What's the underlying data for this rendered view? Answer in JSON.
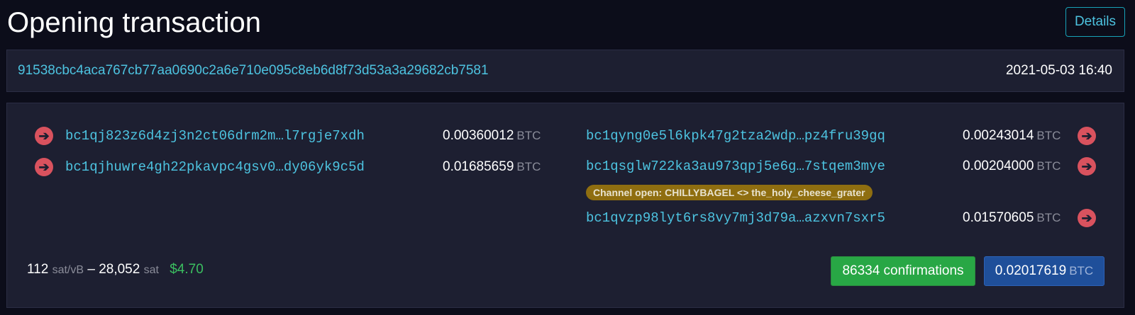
{
  "header": {
    "title": "Opening transaction",
    "details_label": "Details"
  },
  "tx": {
    "txid": "91538cbc4aca767cb77aa0690c2a6e710e095c8eb6d8f73d53a3a29682cb7581",
    "time": "2021-05-03 16:40"
  },
  "inputs": [
    {
      "address": "bc1qj823z6d4zj3n2ct06drm2m…l7rgje7xdh",
      "amount": "0.00360012",
      "unit": "BTC"
    },
    {
      "address": "bc1qjhuwre4gh22pkavpc4gsv0…dy06yk9c5d",
      "amount": "0.01685659",
      "unit": "BTC"
    }
  ],
  "outputs": [
    {
      "address": "bc1qyng0e5l6kpk47g2tza2wdp…pz4fru39gq",
      "amount": "0.00243014",
      "unit": "BTC"
    },
    {
      "address": "bc1qsglw722ka3au973qpj5e6g…7stqem3mye",
      "amount": "0.00204000",
      "unit": "BTC"
    },
    {
      "address": "bc1qvzp98lyt6rs8vy7mj3d79a…azxvn7sxr5",
      "amount": "0.01570605",
      "unit": "BTC"
    }
  ],
  "channel_badge": "Channel open: CHILLYBAGEL <> the_holy_cheese_grater",
  "fee": {
    "rate": "112",
    "rate_unit": "sat/vB",
    "separator": "–",
    "total": "28,052",
    "total_unit": "sat",
    "usd": "$4.70"
  },
  "confirmations": "86334 confirmations",
  "total_output": {
    "amount": "0.02017619",
    "unit": "BTC"
  },
  "icons": {
    "arrow": "arrow-right-circle-icon"
  },
  "colors": {
    "arrow": "#d9525e",
    "link": "#4dc3e0",
    "confirm": "#28a745",
    "total": "#1f4f9a",
    "badge": "#8f6e10"
  }
}
